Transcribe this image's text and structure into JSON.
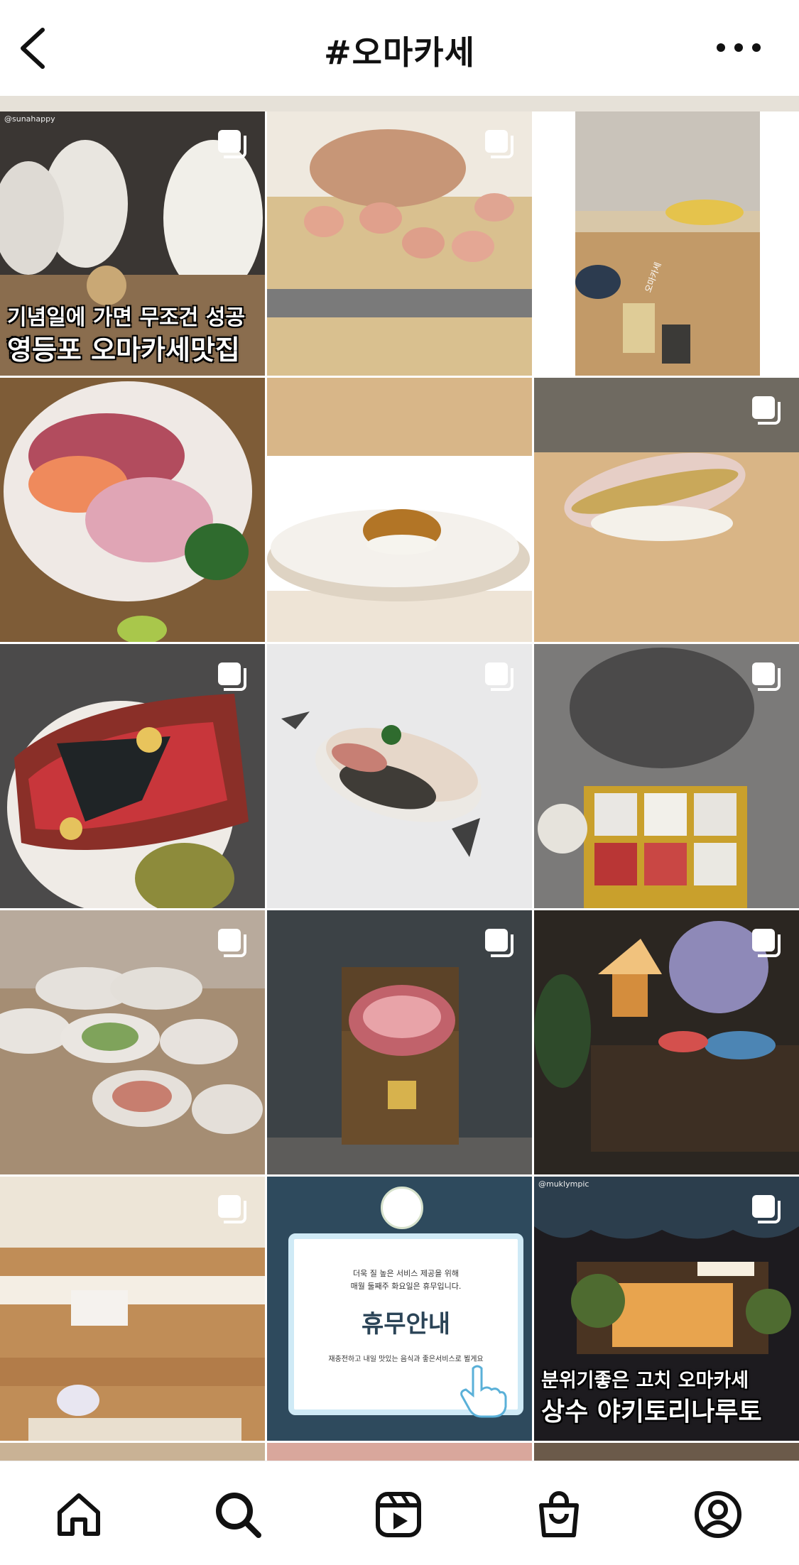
{
  "header": {
    "title": "#오마카세",
    "back_icon": "chevron-left-icon",
    "more_icon": "more-horizontal-icon"
  },
  "grid": {
    "items": [
      {
        "caption_line1": "기념일에 가면 무조건 성공할",
        "caption_line2": "영등포 오마카세맛집",
        "handle": "@sunahappy"
      },
      {},
      {
        "overlay": "오마카세"
      },
      {},
      {},
      {},
      {},
      {},
      {},
      {},
      {},
      {},
      {},
      {
        "notice_line1": "더욱 질 높은 서비스 제공을 위해",
        "notice_line2": "매월 둘째주 화요일은 휴무입니다.",
        "notice_title": "휴무안내",
        "notice_body": "재충전하고 내일 맛있는 음식과 좋은서비스로 뵐게요"
      },
      {
        "caption_line1": "분위기좋은 고치 오마카세",
        "caption_line2": "상수 야키토리나루토",
        "handle": "@muklympic"
      }
    ]
  },
  "nav": {
    "items": [
      {
        "name": "home",
        "icon": "home-icon"
      },
      {
        "name": "search",
        "icon": "search-icon"
      },
      {
        "name": "reels",
        "icon": "reels-icon"
      },
      {
        "name": "shop",
        "icon": "shopping-bag-icon"
      },
      {
        "name": "profile",
        "icon": "profile-icon"
      }
    ]
  }
}
